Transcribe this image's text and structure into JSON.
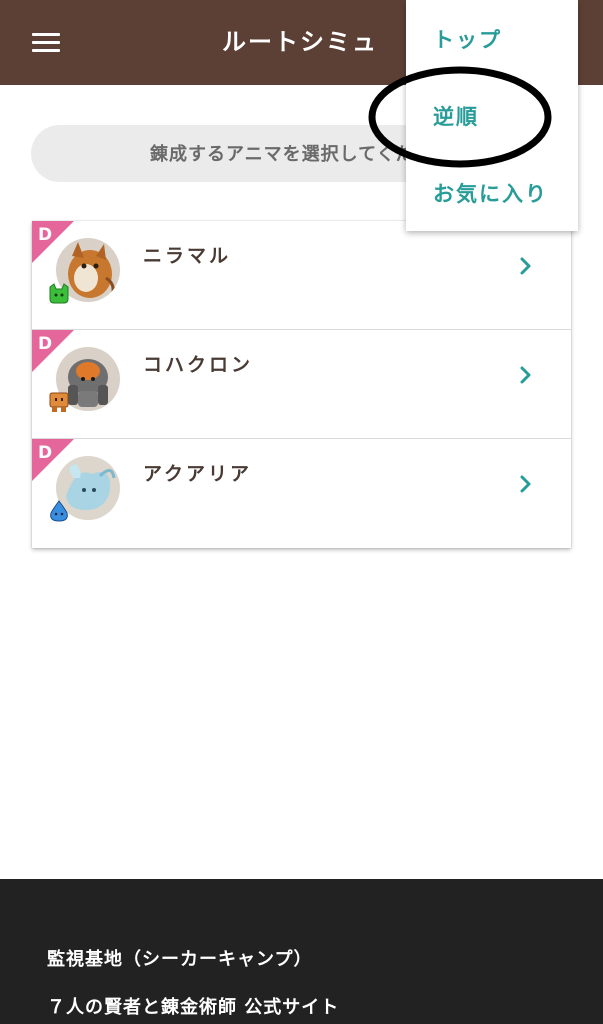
{
  "header": {
    "title": "ルートシミュ",
    "menu_icon": "hamburger-menu-icon",
    "background": "#5c4035"
  },
  "search": {
    "placeholder": "錬成するアニマを選択してください"
  },
  "dropdown": {
    "items": [
      {
        "label": "トップ"
      },
      {
        "label": "逆順"
      },
      {
        "label": "お気に入り"
      }
    ],
    "accent": "#279c98"
  },
  "anima_list": [
    {
      "rank": "D",
      "name": "ニラマル",
      "attribute_icon": "green-cat-attribute-icon",
      "chevron_icon": "chevron-right-icon"
    },
    {
      "rank": "D",
      "name": "コハクロン",
      "attribute_icon": "orange-block-attribute-icon",
      "chevron_icon": "chevron-right-icon"
    },
    {
      "rank": "D",
      "name": "アクアリア",
      "attribute_icon": "blue-drop-attribute-icon",
      "chevron_icon": "chevron-right-icon"
    }
  ],
  "badge_color": "#e4669a",
  "footer": {
    "links": [
      {
        "label": "監視基地（シーカーキャンプ）"
      },
      {
        "label": "７人の賢者と錬金術師 公式サイト"
      }
    ]
  }
}
